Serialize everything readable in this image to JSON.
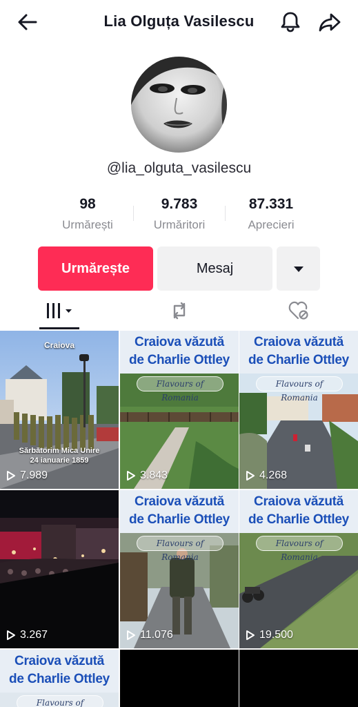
{
  "header": {
    "title": "Lia Olguța Vasilescu",
    "back_icon": "arrow-left-icon",
    "bell_icon": "bell-icon",
    "share_icon": "share-arrow-icon"
  },
  "profile": {
    "handle": "@lia_olguta_vasilescu",
    "avatar_icon": "avatar-portrait"
  },
  "stats": [
    {
      "value": "98",
      "label": "Urmărești"
    },
    {
      "value": "9.783",
      "label": "Urmăritori"
    },
    {
      "value": "87.331",
      "label": "Aprecieri"
    }
  ],
  "actions": {
    "follow_label": "Urmărește",
    "message_label": "Mesaj",
    "more_icon": "caret-down-icon"
  },
  "tabs": [
    {
      "name": "videos",
      "icon": "grid-bars-icon",
      "active": true
    },
    {
      "name": "reposts",
      "icon": "repost-icon",
      "active": false
    },
    {
      "name": "liked",
      "icon": "heart-hidden-icon",
      "active": false
    }
  ],
  "videos": [
    {
      "views": "7.989",
      "overlay_top": "Craiova",
      "overlay_bottom": "Sărbătorim Mica Unire",
      "overlay_bottom2": "24 ianuarie 1859"
    },
    {
      "views": "3.843",
      "title1": "Craiova văzută",
      "title2": "de Charlie Ottley",
      "subtitle": "Flavours of Romania"
    },
    {
      "views": "4.268",
      "title1": "Craiova văzută",
      "title2": "de Charlie Ottley",
      "subtitle": "Flavours of Romania"
    },
    {
      "views": "3.267"
    },
    {
      "views": "11.076",
      "title1": "Craiova văzută",
      "title2": "de Charlie Ottley",
      "subtitle": "Flavours of Romania"
    },
    {
      "views": "19.500",
      "title1": "Craiova văzută",
      "title2": "de Charlie Ottley",
      "subtitle": "Flavours of Romania"
    },
    {
      "title1": "Craiova văzută",
      "title2": "de Charlie Ottley",
      "subtitle": "Flavours of Romania"
    }
  ],
  "colors": {
    "accent": "#fe2c55",
    "button_gray": "#f1f1f2",
    "banner_text": "#1b4fb8"
  }
}
